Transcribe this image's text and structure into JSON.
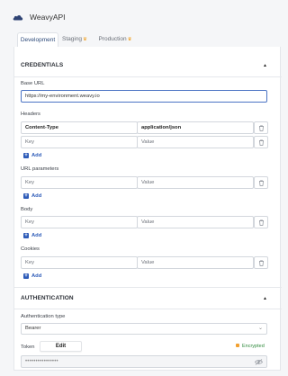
{
  "app": {
    "title": "WeavyAPI"
  },
  "tabs": [
    {
      "label": "Development",
      "active": true,
      "premium": false
    },
    {
      "label": "Staging",
      "active": false,
      "premium": true
    },
    {
      "label": "Production",
      "active": false,
      "premium": true
    }
  ],
  "credentials": {
    "title": "CREDENTIALS",
    "base_url_label": "Base URL",
    "base_url_value": "https://my-environment.weavy.io",
    "headers_label": "Headers",
    "headers": [
      {
        "key": "Content-Type",
        "value": "application/json"
      },
      {
        "key": "Key",
        "value": "Value"
      }
    ],
    "url_params_label": "URL parameters",
    "url_params": [
      {
        "key": "Key",
        "value": "Value"
      }
    ],
    "body_label": "Body",
    "body": [
      {
        "key": "Key",
        "value": "Value"
      }
    ],
    "cookies_label": "Cookies",
    "cookies": [
      {
        "key": "Key",
        "value": "Value"
      }
    ],
    "add_label": "Add"
  },
  "authentication": {
    "title": "AUTHENTICATION",
    "type_label": "Authentication type",
    "type_value": "Bearer",
    "token_label": "Token",
    "edit_label": "Edit",
    "encrypted_label": "Encrypted",
    "token_value": "••••••••••••••••"
  },
  "colors": {
    "accent": "#2d5bb8",
    "focus": "#4b74c4",
    "premium": "#f0a023",
    "encrypted": "#2f8a3c"
  },
  "icons": [
    "cloud-icon",
    "crown-icon",
    "trash-icon",
    "plus-icon",
    "chevron-up-icon",
    "chevron-down-icon",
    "eye-off-icon",
    "lock-icon"
  ]
}
